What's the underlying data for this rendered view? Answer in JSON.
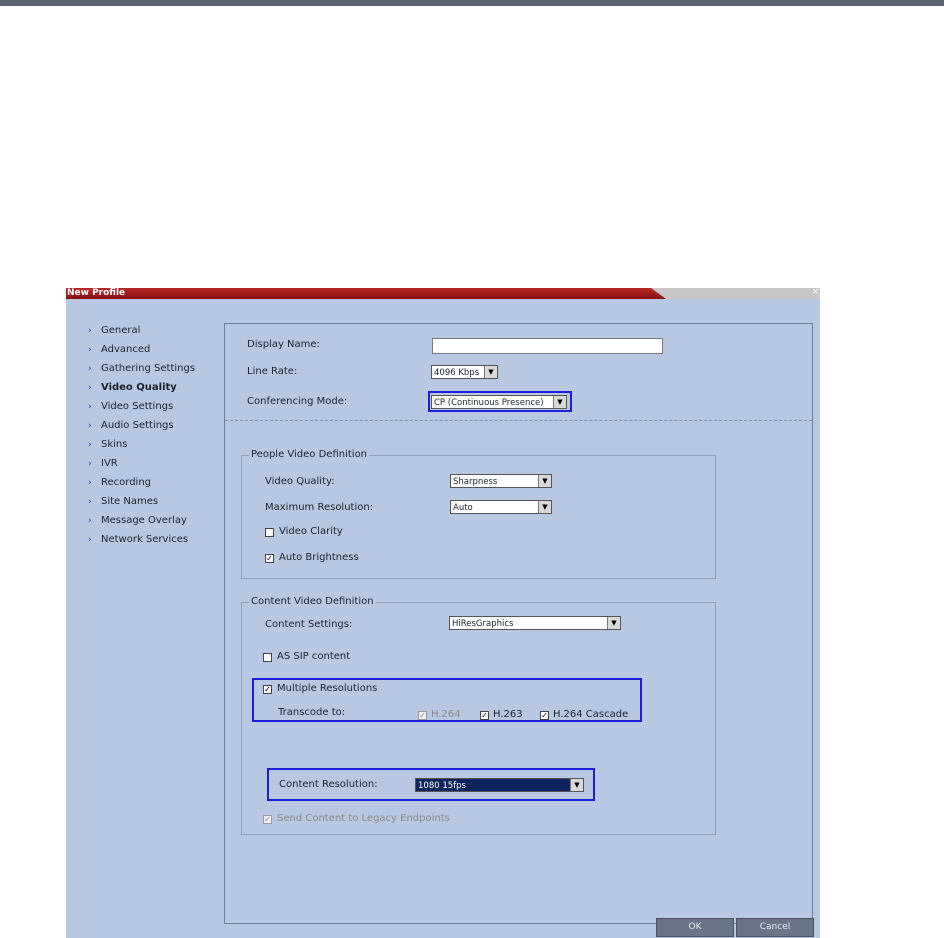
{
  "window": {
    "title": "New Profile",
    "close_glyph": "×"
  },
  "nav": {
    "items": [
      {
        "label": "General",
        "active": false
      },
      {
        "label": "Advanced",
        "active": false
      },
      {
        "label": "Gathering Settings",
        "active": false
      },
      {
        "label": "Video Quality",
        "active": true
      },
      {
        "label": "Video Settings",
        "active": false
      },
      {
        "label": "Audio Settings",
        "active": false
      },
      {
        "label": "Skins",
        "active": false
      },
      {
        "label": "IVR",
        "active": false
      },
      {
        "label": "Recording",
        "active": false
      },
      {
        "label": "Site Names",
        "active": false
      },
      {
        "label": "Message Overlay",
        "active": false
      },
      {
        "label": "Network Services",
        "active": false
      }
    ]
  },
  "form": {
    "display_name_label": "Display Name:",
    "display_name_value": "",
    "line_rate_label": "Line Rate:",
    "line_rate_value": "4096 Kbps",
    "conferencing_mode_label": "Conferencing Mode:",
    "conferencing_mode_value": "CP (Continuous Presence)"
  },
  "people_video": {
    "title": "People Video Definition",
    "video_quality_label": "Video Quality:",
    "video_quality_value": "Sharpness",
    "max_resolution_label": "Maximum Resolution:",
    "max_resolution_value": "Auto",
    "video_clarity_label": "Video Clarity",
    "video_clarity_checked": false,
    "auto_brightness_label": "Auto Brightness",
    "auto_brightness_checked": true
  },
  "content_video": {
    "title": "Content Video Definition",
    "content_settings_label": "Content Settings:",
    "content_settings_value": "HiResGraphics",
    "as_sip_label": "AS SIP content",
    "as_sip_checked": false,
    "multiple_resolutions_label": "Multiple Resolutions",
    "multiple_resolutions_checked": true,
    "transcode_label": "Transcode to:",
    "transcode_options": [
      {
        "label": "H.264",
        "checked": true,
        "disabled": true
      },
      {
        "label": "H.263",
        "checked": true,
        "disabled": false
      },
      {
        "label": "H.264 Cascade",
        "checked": true,
        "disabled": false
      }
    ],
    "content_resolution_label": "Content Resolution:",
    "content_resolution_value": "1080 15fps",
    "send_legacy_label": "Send Content to Legacy Endpoints",
    "send_legacy_checked": true
  },
  "buttons": {
    "ok": "OK",
    "cancel": "Cancel"
  },
  "glyphs": {
    "check": "✓",
    "dropdown": "▼",
    "nav_arrow": "›"
  },
  "colors": {
    "title_red": "#a31b1b",
    "highlight_blue": "#1d1ddd",
    "panel_bg": "#b8c7e2"
  }
}
